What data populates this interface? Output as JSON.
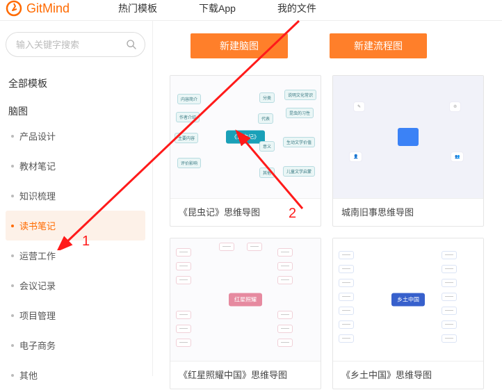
{
  "header": {
    "brand": "GitMind",
    "nav": [
      "热门模板",
      "下载App",
      "我的文件"
    ]
  },
  "search": {
    "placeholder": "输入关键字搜索"
  },
  "sidebar": {
    "root": "全部模板",
    "heading": "脑图",
    "items": [
      {
        "label": "产品设计",
        "active": false
      },
      {
        "label": "教材笔记",
        "active": false
      },
      {
        "label": "知识梳理",
        "active": false
      },
      {
        "label": "读书笔记",
        "active": true
      },
      {
        "label": "运营工作",
        "active": false
      },
      {
        "label": "会议记录",
        "active": false
      },
      {
        "label": "项目管理",
        "active": false
      },
      {
        "label": "电子商务",
        "active": false
      },
      {
        "label": "其他",
        "active": false
      }
    ]
  },
  "buttons": {
    "new_mindmap": "新建脑图",
    "new_flowchart": "新建流程图"
  },
  "templates": [
    {
      "title": "《昆虫记》思维导图"
    },
    {
      "title": "城南旧事思维导图"
    },
    {
      "title": "《红星照耀中国》思维导图"
    },
    {
      "title": "《乡土中国》思维导图"
    }
  ],
  "annotations": {
    "one": "1",
    "two": "2"
  }
}
